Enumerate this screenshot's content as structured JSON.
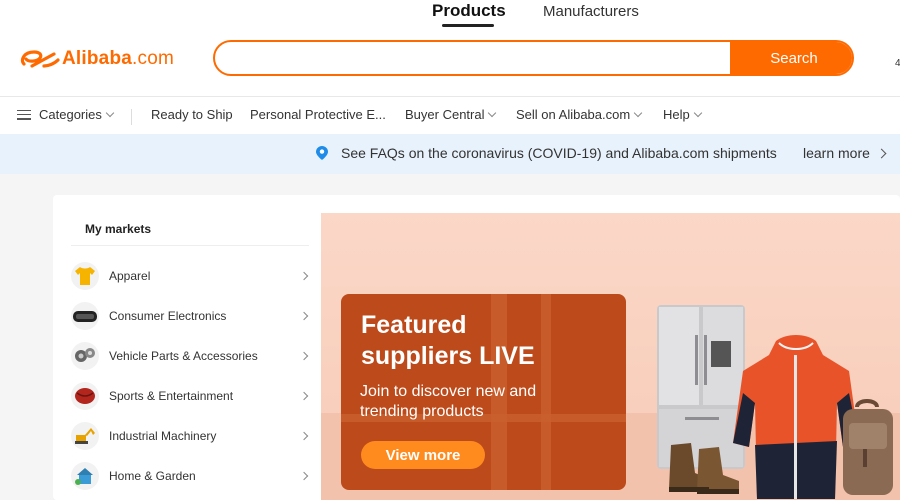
{
  "header": {
    "tabs": [
      "Products",
      "Manufacturers"
    ],
    "logo_text": "Alibaba",
    "logo_suffix": ".com",
    "search": {
      "placeholder": "",
      "value": "",
      "button_label": "Search"
    },
    "edge_glyph": "4"
  },
  "nav": {
    "categories_label": "Categories",
    "items": [
      {
        "label": "Ready to Ship"
      },
      {
        "label": "Personal Protective E..."
      },
      {
        "label": "Buyer Central"
      },
      {
        "label": "Sell on Alibaba.com"
      },
      {
        "label": "Help"
      }
    ]
  },
  "notice": {
    "text": "See FAQs on the coronavirus (COVID-19) and Alibaba.com shipments",
    "link_label": "learn more"
  },
  "markets": {
    "title": "My markets",
    "items": [
      {
        "label": "Apparel",
        "icon": "tshirt-icon"
      },
      {
        "label": "Consumer Electronics",
        "icon": "vr-headset-icon"
      },
      {
        "label": "Vehicle Parts & Accessories",
        "icon": "car-parts-icon"
      },
      {
        "label": "Sports & Entertainment",
        "icon": "sports-gear-icon"
      },
      {
        "label": "Industrial Machinery",
        "icon": "excavator-icon"
      },
      {
        "label": "Home & Garden",
        "icon": "home-garden-icon"
      }
    ]
  },
  "banner": {
    "title_line1": "Featured",
    "title_line2": "suppliers LIVE",
    "subtitle_line1": "Join to discover new and",
    "subtitle_line2": "trending products",
    "button_label": "View more"
  },
  "colors": {
    "brand": "#ff6a00",
    "notice_bg": "#e8f2fc",
    "banner_box": "#bd4a1a",
    "banner_button": "#ff8a1e"
  }
}
